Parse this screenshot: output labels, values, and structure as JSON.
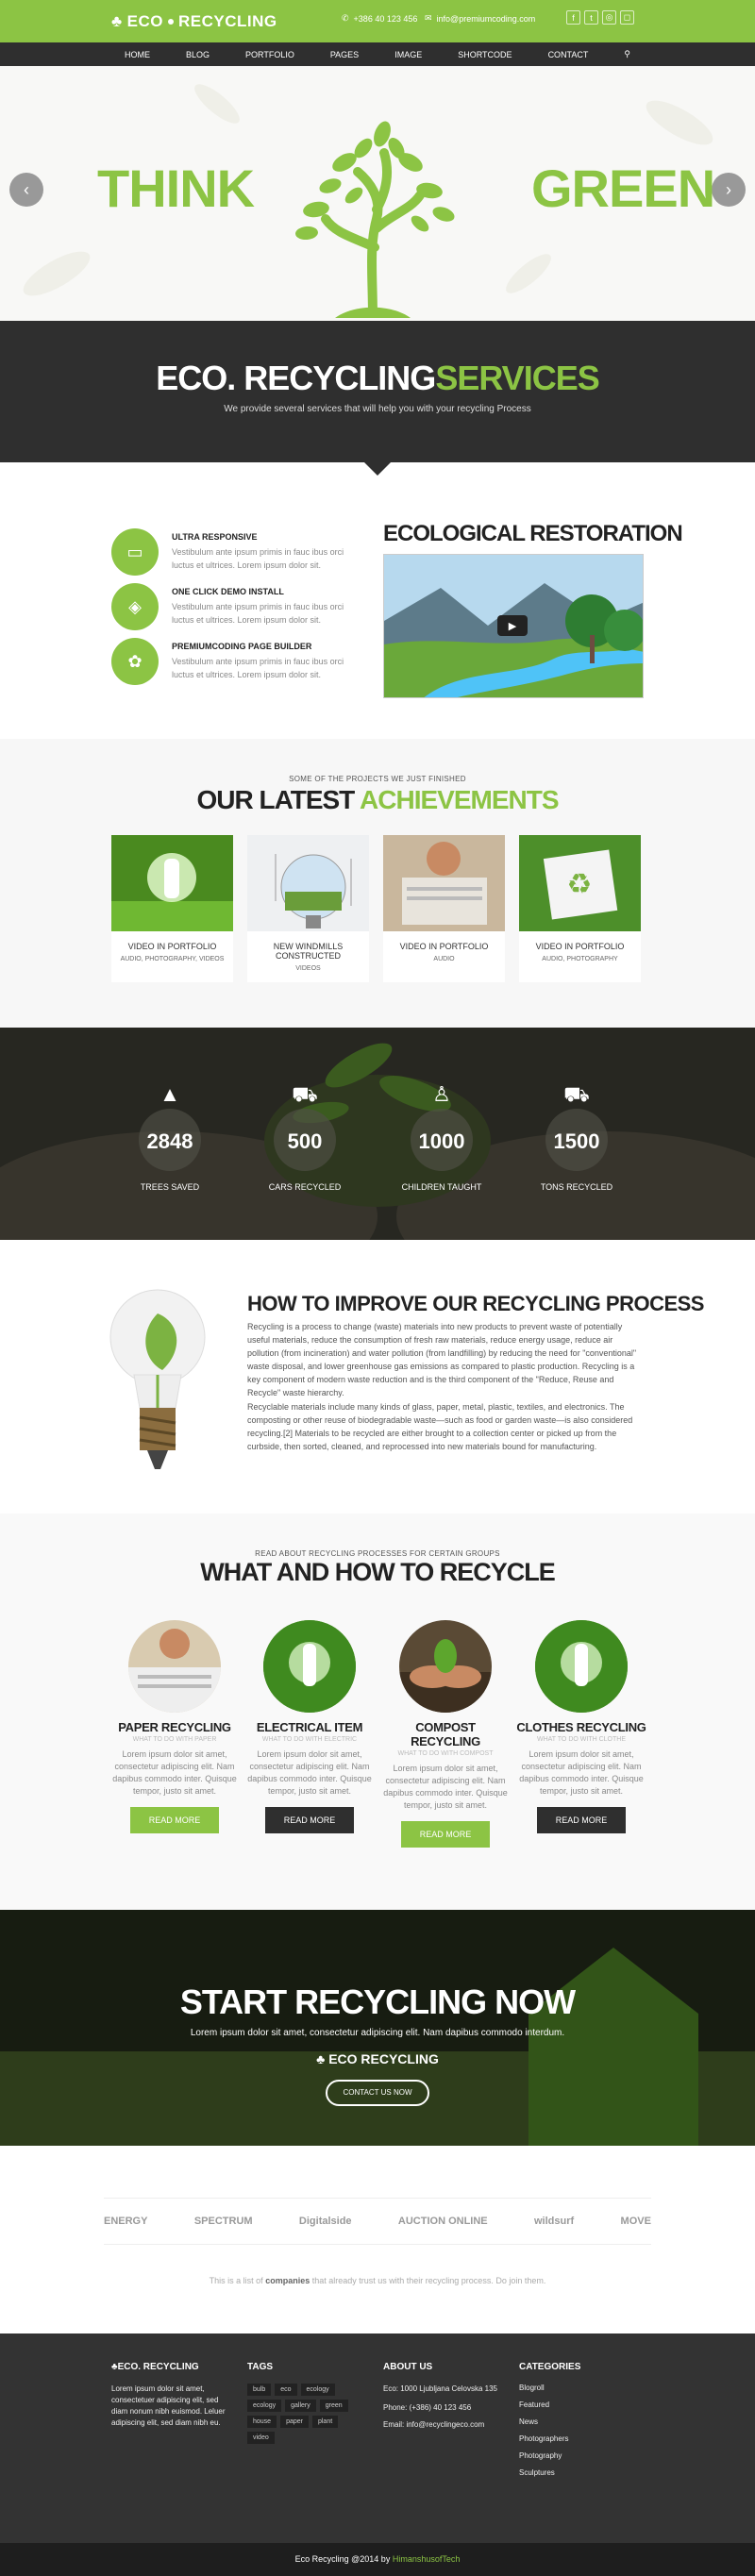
{
  "brand": {
    "name": "ECO",
    "name2": "RECYCLING"
  },
  "contact": {
    "phone": "+386 40 123 456",
    "email": "info@premiumcoding.com"
  },
  "socials": [
    "f",
    "t",
    "◎",
    "◻"
  ],
  "nav": [
    "HOME",
    "BLOG",
    "PORTFOLIO",
    "PAGES",
    "IMAGE",
    "SHORTCODE",
    "CONTACT"
  ],
  "hero": {
    "left": "THINK",
    "right": "GREEN"
  },
  "services": {
    "title_a": "ECO",
    "title_b": "RECYCLING",
    "title_c": "SERVICES",
    "subtitle": "We provide several services that will help you with your recycling Process"
  },
  "features": [
    {
      "title": "ULTRA RESPONSIVE",
      "text": "Vestibulum ante ipsum primis in fauc ibus orci luctus et ultrices. Lorem ipsum dolor sit."
    },
    {
      "title": "ONE CLICK DEMO INSTALL",
      "text": "Vestibulum ante ipsum primis in fauc ibus orci luctus et ultrices. Lorem ipsum dolor sit."
    },
    {
      "title": "PREMIUMCODING PAGE BUILDER",
      "text": "Vestibulum ante ipsum primis in fauc ibus orci luctus et ultrices. Lorem ipsum dolor sit."
    }
  ],
  "eco_title": "ECOLOGICAL RESTORATION",
  "achievements": {
    "kicker": "SOME OF THE PROJECTS WE JUST FINISHED",
    "title_a": "OUR LATEST",
    "title_b": "ACHIEVEMENTS",
    "items": [
      {
        "title": "VIDEO IN PORTFOLIO",
        "sub": "AUDIO, PHOTOGRAPHY, VIDEOS"
      },
      {
        "title": "NEW WINDMILLS CONSTRUCTED",
        "sub": "VIDEOS"
      },
      {
        "title": "VIDEO IN PORTFOLIO",
        "sub": "AUDIO"
      },
      {
        "title": "VIDEO IN PORTFOLIO",
        "sub": "AUDIO, PHOTOGRAPHY"
      }
    ]
  },
  "stats": [
    {
      "num": "2848",
      "label": "TREES SAVED"
    },
    {
      "num": "500",
      "label": "CARS RECYCLED"
    },
    {
      "num": "1000",
      "label": "CHILDREN TAUGHT"
    },
    {
      "num": "1500",
      "label": "TONS RECYCLED"
    }
  ],
  "how": {
    "title": "HOW TO IMPROVE OUR RECYCLING PROCESS",
    "p1": "Recycling is a process to change (waste) materials into new products to prevent waste of potentially useful materials, reduce the consumption of fresh raw materials, reduce energy usage, reduce air pollution (from incineration) and water pollution (from landfilling) by reducing the need for \"conventional\" waste disposal, and lower greenhouse gas emissions as compared to plastic production. Recycling is a key component of modern waste reduction and is the third component of the \"Reduce, Reuse and Recycle\" waste hierarchy.",
    "p2": "Recyclable materials include many kinds of glass, paper, metal, plastic, textiles, and electronics. The composting or other reuse of biodegradable waste—such as food or garden waste—is also considered recycling.[2] Materials to be recycled are either brought to a collection center or picked up from the curbside, then sorted, cleaned, and reprocessed into new materials bound for manufacturing."
  },
  "recycle": {
    "kicker": "READ ABOUT RECYCLING PROCESSES FOR CERTAIN GROUPS",
    "title": "WHAT AND HOW TO RECYCLE",
    "items": [
      {
        "title": "PAPER RECYCLING",
        "sub": "WHAT TO DO WITH PAPER",
        "text": "Lorem ipsum dolor sit amet, consectetur adipiscing elit. Nam dapibus commodo inter. Quisque tempor, justo sit amet.",
        "btn": "READ MORE"
      },
      {
        "title": "ELECTRICAL ITEM",
        "sub": "WHAT TO DO WITH ELECTRIC",
        "text": "Lorem ipsum dolor sit amet, consectetur adipiscing elit. Nam dapibus commodo inter. Quisque tempor, justo sit amet.",
        "btn": "READ MORE"
      },
      {
        "title": "COMPOST RECYCLING",
        "sub": "WHAT TO DO WITH COMPOST",
        "text": "Lorem ipsum dolor sit amet, consectetur adipiscing elit. Nam dapibus commodo inter. Quisque tempor, justo sit amet.",
        "btn": "READ MORE"
      },
      {
        "title": "CLOTHES RECYCLING",
        "sub": "WHAT TO DO WITH CLOTHE",
        "text": "Lorem ipsum dolor sit amet, consectetur adipiscing elit. Nam dapibus commodo inter. Quisque tempor, justo sit amet.",
        "btn": "READ MORE"
      }
    ]
  },
  "cta": {
    "title": "START RECYCLING NOW",
    "text": "Lorem ipsum dolor sit amet, consectetur adipiscing elit. Nam dapibus commodo interdum.",
    "logo": "ECO RECYCLING",
    "btn": "CONTACT US NOW"
  },
  "partners": {
    "logos": [
      "ENERGY",
      "SPECTRUM",
      "Digitalside",
      "AUCTION ONLINE",
      "wildsurf",
      "MOVE"
    ],
    "note_a": "This is a list of",
    "note_b": "companies",
    "note_c": "that already trust us with their recycling process. Do join them."
  },
  "footer": {
    "about_text": "Lorem ipsum dolor sit amet, consectetuer adipiscing elit, sed diam nonum nibh euismod. Leluer adipiscing elit, sed diam nibh eu.",
    "tags_title": "TAGS",
    "tags": [
      "bulb",
      "eco",
      "ecology",
      "ecology",
      "gallery",
      "green",
      "house",
      "paper",
      "plant",
      "video"
    ],
    "about_title": "ABOUT US",
    "eco": "Eco: 1000 Ljubljana Celovska 135",
    "phone": "Phone: (+386) 40 123 456",
    "email": "Email: info@recyclingeco.com",
    "cat_title": "CATEGORIES",
    "cats": [
      "Blogroll",
      "Featured",
      "News",
      "Photographers",
      "Photography",
      "Sculptures"
    ]
  },
  "bottom": {
    "a": "Eco Recycling @2014 by",
    "b": "HimanshusofTech"
  },
  "colors": {
    "accent": "#8cc444",
    "dark": "#2f2f2f"
  }
}
